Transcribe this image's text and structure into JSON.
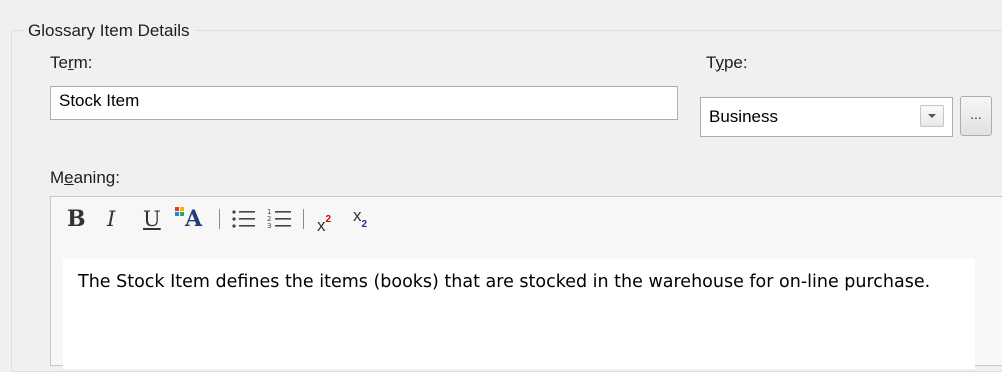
{
  "group": {
    "title": "Glossary Item Details"
  },
  "term": {
    "label_prefix": "Te",
    "label_accel": "r",
    "label_suffix": "m:",
    "value": "Stock Item"
  },
  "type": {
    "label_prefix": "T",
    "label_accel": "y",
    "label_suffix": "pe:",
    "value": "Business",
    "ellipsis": "..."
  },
  "meaning": {
    "label_prefix": "M",
    "label_accel": "e",
    "label_suffix": "aning:",
    "text": "The Stock Item defines the items (books) that are stocked in the warehouse for on-line purchase."
  },
  "toolbar": {
    "bold": "B",
    "italic": "I",
    "underline": "U",
    "font_color": "A",
    "superscript_base": "x",
    "superscript_mark": "2",
    "subscript_base": "x",
    "subscript_mark": "2"
  },
  "icons": [
    "dropdown-arrow-icon",
    "font-color-icon",
    "bullet-list-icon",
    "numbered-list-icon"
  ],
  "colors": {
    "accent_red": "#d00000",
    "accent_blue": "#1a3a9a",
    "border": "#abadb3",
    "background": "#f0f0f0"
  }
}
